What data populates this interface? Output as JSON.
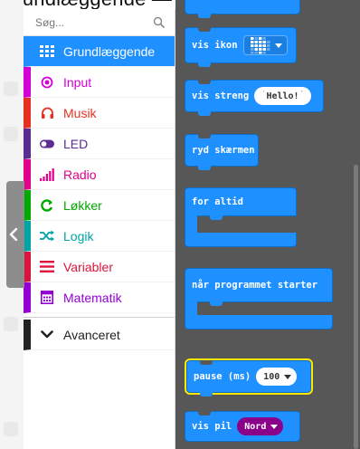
{
  "heading": "Grundlæggende — pause",
  "search": {
    "placeholder": "Søg..."
  },
  "categories": [
    {
      "label": "Grundlæggende",
      "color": "#1e90ff",
      "icon": "grid-icon",
      "active": true
    },
    {
      "label": "Input",
      "color": "#d400d4",
      "icon": "radio-button-icon"
    },
    {
      "label": "Musik",
      "color": "#e63022",
      "icon": "headphones-icon"
    },
    {
      "label": "LED",
      "color": "#5c2d91",
      "icon": "toggle-icon"
    },
    {
      "label": "Radio",
      "color": "#e3008c",
      "icon": "signal-bars-icon"
    },
    {
      "label": "Løkker",
      "color": "#00aa00",
      "icon": "loop-arrow-icon"
    },
    {
      "label": "Logik",
      "color": "#00a4a6",
      "icon": "shuffle-icon"
    },
    {
      "label": "Variabler",
      "color": "#dc143c",
      "icon": "lines-icon"
    },
    {
      "label": "Matematik",
      "color": "#9400d3",
      "icon": "calculator-icon"
    }
  ],
  "advanced": {
    "label": "Avanceret",
    "icon": "chevron-down-icon"
  },
  "blocks": {
    "show_icon": "vis ikon",
    "show_string": "vis streng",
    "show_string_value": "Hello!",
    "clear_screen": "ryd skærmen",
    "forever": "for altid",
    "on_start": "når programmet starter",
    "pause": "pause (ms)",
    "pause_value": "100",
    "show_arrow": "vis pil",
    "show_arrow_value": "Nord"
  },
  "colors": {
    "workspace": "#575757",
    "block_blue": "#1e90ff",
    "selected": "#ffe600",
    "arrow_purple": "#8b008b"
  }
}
